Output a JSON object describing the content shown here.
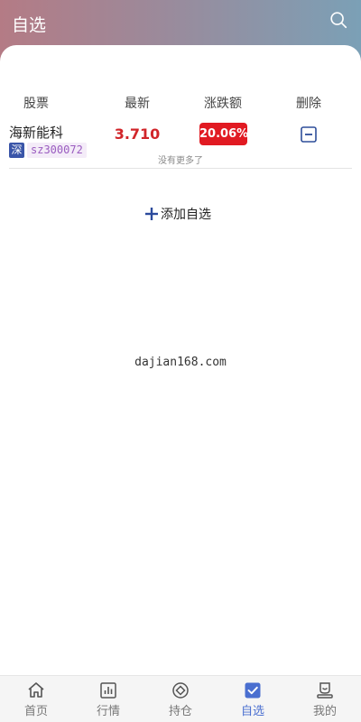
{
  "header": {
    "title": "自选",
    "search_icon": "search-icon"
  },
  "table": {
    "headers": {
      "stock": "股票",
      "latest": "最新",
      "change": "涨跌额",
      "delete": "删除"
    },
    "rows": [
      {
        "name": "海新能科",
        "market": "深",
        "code": "sz300072",
        "price": "3.710",
        "change": "20.06%"
      }
    ]
  },
  "list": {
    "no_more": "没有更多了",
    "add_label": "添加自选"
  },
  "watermark": "dajian168.com",
  "colors": {
    "accent": "#4a6fd0",
    "up": "#e11a22",
    "market_badge": "#3a55a8"
  },
  "tabs": [
    {
      "label": "首页",
      "icon": "home-icon"
    },
    {
      "label": "行情",
      "icon": "chart-icon"
    },
    {
      "label": "持仓",
      "icon": "position-icon"
    },
    {
      "label": "自选",
      "icon": "checkbox-icon",
      "active": true
    },
    {
      "label": "我的",
      "icon": "user-icon"
    }
  ]
}
